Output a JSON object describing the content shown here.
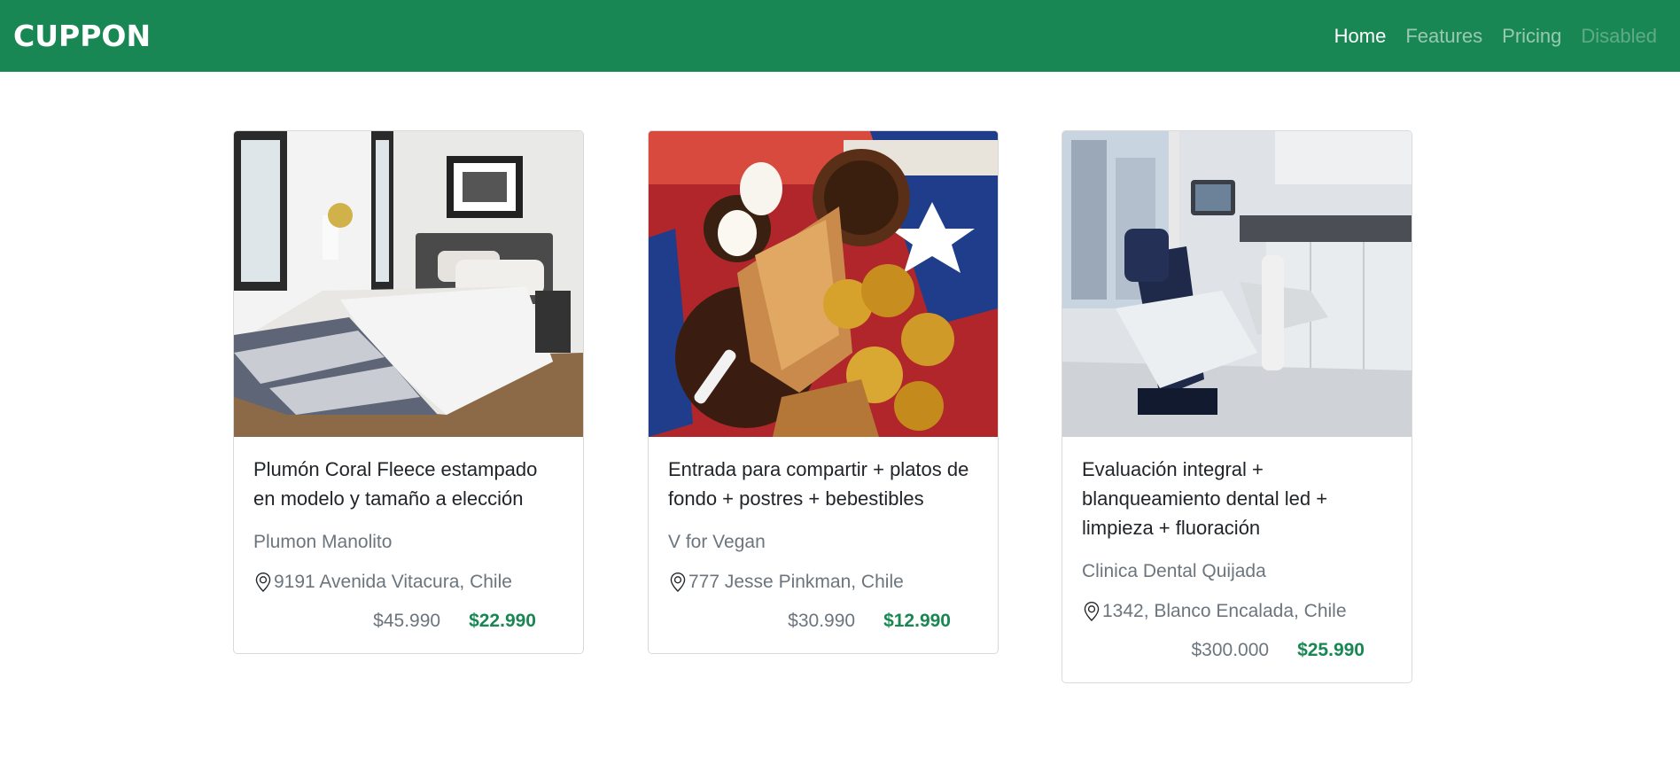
{
  "navbar": {
    "brand": "CUPPON",
    "links": [
      {
        "label": "Home",
        "state": "active"
      },
      {
        "label": "Features",
        "state": "normal"
      },
      {
        "label": "Pricing",
        "state": "normal"
      },
      {
        "label": "Disabled",
        "state": "disabled"
      }
    ]
  },
  "deals": [
    {
      "title": "Plumón Coral Fleece estampado en modelo y tamaño a elección",
      "seller": "Plumon Manolito",
      "location": "9191 Avenida Vitacura, Chile",
      "old_price": "$45.990",
      "new_price": "$22.990",
      "image": "bedroom-photo"
    },
    {
      "title": "Entrada para compartir + platos de fondo + postres + bebestibles",
      "seller": "V for Vegan",
      "location": "777 Jesse Pinkman, Chile",
      "old_price": "$30.990",
      "new_price": "$12.990",
      "image": "chilean-food-photo"
    },
    {
      "title": "Evaluación integral + blanqueamiento dental led + limpieza + fluoración",
      "seller": "Clinica Dental Quijada",
      "location": "1342, Blanco Encalada, Chile",
      "old_price": "$300.000",
      "new_price": "$25.990",
      "image": "dental-clinic-photo"
    }
  ],
  "colors": {
    "brand_green": "#198754",
    "muted_text": "#6c757d"
  }
}
